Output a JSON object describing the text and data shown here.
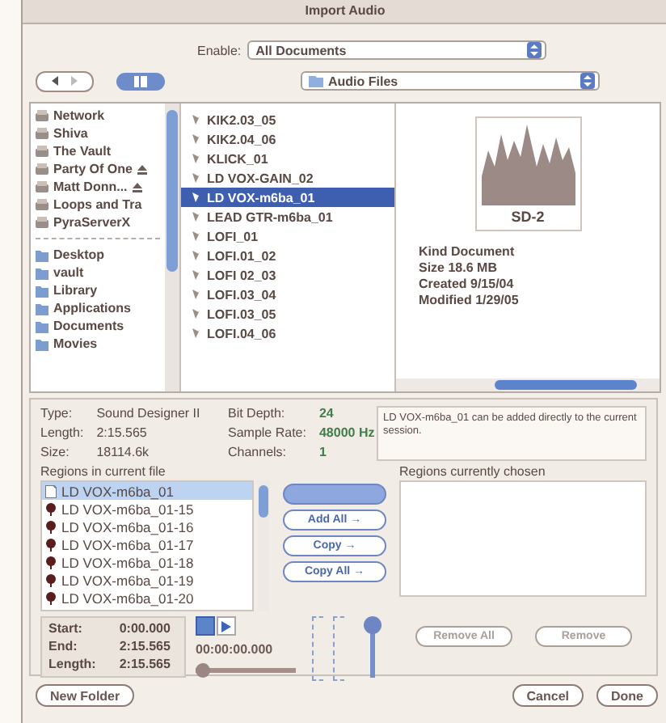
{
  "window": {
    "title": "Import Audio"
  },
  "enable": {
    "label": "Enable:",
    "value": "All Documents"
  },
  "location": {
    "value": "Audio Files"
  },
  "sidebar": {
    "groups": [
      [
        {
          "label": "Network",
          "eject": false
        },
        {
          "label": "Shiva",
          "eject": false
        },
        {
          "label": "The Vault",
          "eject": false
        },
        {
          "label": "Party Of One",
          "eject": true
        },
        {
          "label": "Matt Donn...",
          "eject": true
        },
        {
          "label": "Loops and Tra",
          "eject": false
        },
        {
          "label": "PyraServerX",
          "eject": false
        }
      ],
      [
        {
          "label": "Desktop",
          "eject": false
        },
        {
          "label": "vault",
          "eject": false
        },
        {
          "label": "Library",
          "eject": false
        },
        {
          "label": "Applications",
          "eject": false
        },
        {
          "label": "Documents",
          "eject": false
        },
        {
          "label": "Movies",
          "eject": false
        }
      ]
    ]
  },
  "files": [
    {
      "name": "KIK2.03_05",
      "selected": false
    },
    {
      "name": "KIK2.04_06",
      "selected": false
    },
    {
      "name": "KLICK_01",
      "selected": false
    },
    {
      "name": "LD VOX-GAIN_02",
      "selected": false
    },
    {
      "name": "LD VOX-m6ba_01",
      "selected": true
    },
    {
      "name": "LEAD GTR-m6ba_01",
      "selected": false
    },
    {
      "name": "LOFI_01",
      "selected": false
    },
    {
      "name": "LOFI.01_02",
      "selected": false
    },
    {
      "name": "LOFI 02_03",
      "selected": false
    },
    {
      "name": "LOFI.03_04",
      "selected": false
    },
    {
      "name": "LOFI.03_05",
      "selected": false
    },
    {
      "name": "LOFI.04_06",
      "selected": false
    }
  ],
  "preview": {
    "icon_label": "SD-2",
    "details": [
      "Kind Document",
      "Size 18.6 MB",
      "Created 9/15/04",
      "Modified 1/29/05"
    ]
  },
  "file_info": [
    {
      "label": "Type:",
      "value": "Sound Designer II"
    },
    {
      "label": "Length:",
      "value": "2:15.565"
    },
    {
      "label": "Size:",
      "value": "18114.6k"
    }
  ],
  "format_info": [
    {
      "label": "Bit Depth:",
      "value": "24"
    },
    {
      "label": "Sample Rate:",
      "value": "48000 Hz"
    },
    {
      "label": "Channels:",
      "value": "1"
    }
  ],
  "note": "LD VOX-m6ba_01 can be added directly to the current session.",
  "regions": {
    "heading": "Regions in current file",
    "items": [
      {
        "name": "LD VOX-m6ba_01",
        "kind": "file",
        "selected": true
      },
      {
        "name": "LD VOX-m6ba_01-15",
        "kind": "region",
        "selected": false
      },
      {
        "name": "LD VOX-m6ba_01-16",
        "kind": "region",
        "selected": false
      },
      {
        "name": "LD VOX-m6ba_01-17",
        "kind": "region",
        "selected": false
      },
      {
        "name": "LD VOX-m6ba_01-18",
        "kind": "region",
        "selected": false
      },
      {
        "name": "LD VOX-m6ba_01-19",
        "kind": "region",
        "selected": false
      },
      {
        "name": "LD VOX-m6ba_01-20",
        "kind": "region",
        "selected": false
      }
    ]
  },
  "transfer_buttons": [
    {
      "default": true
    },
    {
      "label": "Add All →",
      "default": false
    },
    {
      "label": "Copy →",
      "default": false
    },
    {
      "label": "Copy All →",
      "default": false
    }
  ],
  "range": [
    {
      "label": "Start:",
      "value": "0:00.000"
    },
    {
      "label": "End:",
      "value": "2:15.565"
    },
    {
      "label": "Length:",
      "value": "2:15.565"
    }
  ],
  "player": {
    "timecode": "00:00:00.000",
    "position": {
      "level": 0
    },
    "volume": {
      "level": 1
    }
  },
  "chosen": {
    "heading": "Regions currently chosen",
    "buttons": [
      {
        "label": "Remove All",
        "disabled": true
      },
      {
        "label": "Remove",
        "disabled": true
      }
    ]
  },
  "footer": {
    "left": [
      {
        "label": "New Folder"
      }
    ],
    "right": [
      {
        "label": "Cancel"
      },
      {
        "label": "Done"
      }
    ]
  }
}
